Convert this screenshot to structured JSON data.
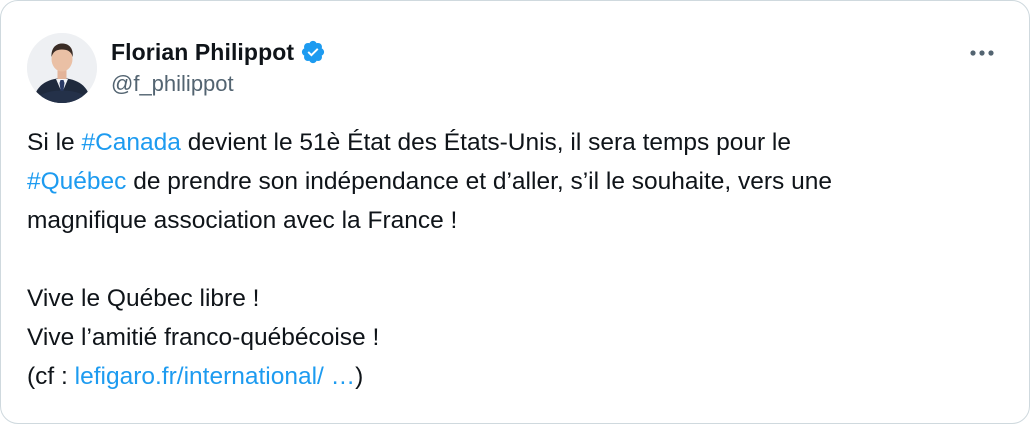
{
  "author": {
    "display_name": "Florian Philippot",
    "handle": "@f_philippot",
    "avatar_icon": "profile-photo",
    "verified_icon": "verified-badge-icon",
    "verified_color": "#1d9bf0"
  },
  "menu": {
    "more_icon": "more-options-icon"
  },
  "tweet": {
    "l1_a": "Si le ",
    "l1_tag": "#Canada",
    "l1_b": " devient le 51è État des États-Unis, il sera temps pour le",
    "l2_tag": "#Québec",
    "l2_b": " de prendre son indépendance et d’aller, s’il le souhaite, vers une",
    "l3": "magnifique association avec la France !",
    "l5": "Vive le Québec libre !",
    "l6": "Vive l’amitié franco-québécoise !",
    "l7_a": "(cf : ",
    "l7_link": "lefigaro.fr/international/ …",
    "l7_b": ")"
  },
  "colors": {
    "link": "#1d9bf0",
    "text": "#0f1419",
    "secondary": "#536471",
    "border": "#cfd9de"
  }
}
